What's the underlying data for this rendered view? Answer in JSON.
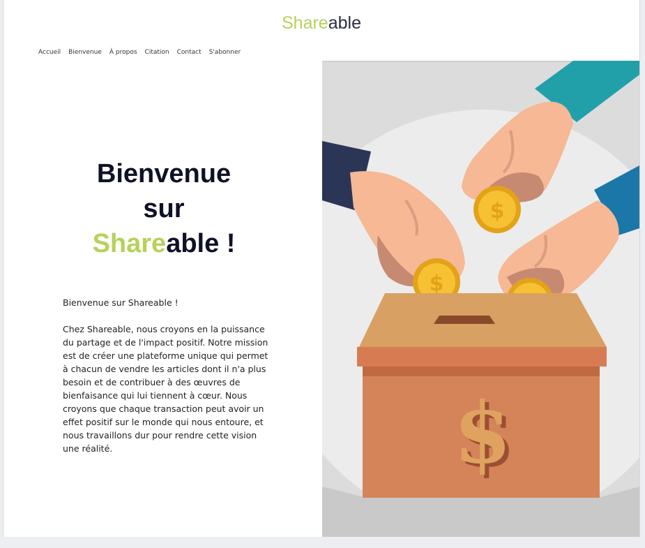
{
  "header": {
    "logo": {
      "part1": "Share",
      "part2": "able"
    }
  },
  "nav": {
    "items": [
      {
        "label": "Accueil"
      },
      {
        "label": "Bienvenue"
      },
      {
        "label": "À propos"
      },
      {
        "label": "Citation"
      },
      {
        "label": "Contact"
      },
      {
        "label": "S'abonner"
      }
    ]
  },
  "hero": {
    "title_line1": "Bienvenue",
    "title_line2": "sur",
    "title_brand_part1": "Share",
    "title_brand_part2": "able !"
  },
  "intro": {
    "heading": "Bienvenue sur Shareable !",
    "paragraph": "Chez Shareable, nous croyons en la puissance du partage et de l'impact positif. Notre mission est de créer une plateforme unique qui permet à chacun de vendre les articles dont il n'a plus besoin et de contribuer à des œuvres de bienfaisance qui lui tiennent à cœur. Nous croyons que chaque transaction peut avoir un effet positif sur le monde qui nous entoure, et nous travaillons dur pour rendre cette vision une réalité."
  },
  "illustration": {
    "icon": "donation-box-illustration",
    "box_symbol": "$"
  },
  "colors": {
    "brand_green": "#b6d15a",
    "brand_dark": "#2a2d3e",
    "title_navy": "#0f1126"
  }
}
